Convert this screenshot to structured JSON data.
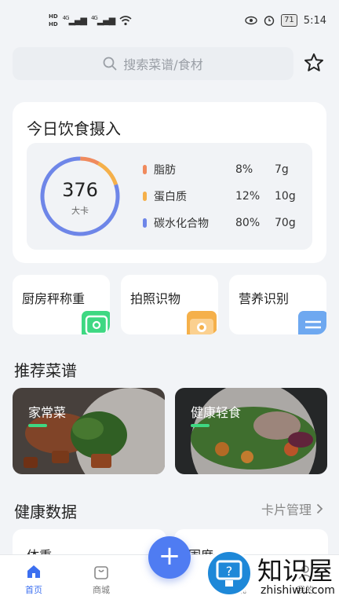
{
  "status_bar": {
    "hd1": "HD",
    "hd2": "HD",
    "signal1": "4G",
    "signal2": "4G",
    "battery": "71",
    "time": "5:14"
  },
  "search": {
    "placeholder": "搜索菜谱/食材"
  },
  "intake": {
    "title": "今日饮食摄入",
    "calories": "376",
    "unit": "大卡",
    "nutrients": [
      {
        "name": "脂肪",
        "percent": "8%",
        "grams": "7g",
        "color": "#f08a5d"
      },
      {
        "name": "蛋白质",
        "percent": "12%",
        "grams": "10g",
        "color": "#f5b04a"
      },
      {
        "name": "碳水化合物",
        "percent": "80%",
        "grams": "70g",
        "color": "#6e86e8"
      }
    ]
  },
  "features": [
    {
      "label": "厨房秤称重",
      "icon": "scale-icon",
      "color": "#3ed882"
    },
    {
      "label": "拍照识物",
      "icon": "camera-icon",
      "color": "#f5b04a"
    },
    {
      "label": "营养识别",
      "icon": "document-icon",
      "color": "#6ea8f0"
    }
  ],
  "recipes": {
    "title": "推荐菜谱",
    "items": [
      {
        "label": "家常菜"
      },
      {
        "label": "健康轻食"
      }
    ]
  },
  "health": {
    "title": "健康数据",
    "manage": "卡片管理",
    "cards": [
      {
        "label": "体重"
      },
      {
        "label": "围度"
      }
    ]
  },
  "tabs": [
    {
      "label": "首页",
      "active": true
    },
    {
      "label": "商城",
      "active": false
    },
    {
      "label": "发现",
      "active": false
    },
    {
      "label": "我的",
      "active": false
    }
  ],
  "watermark": {
    "text": "知识屋",
    "sub": "zhishiwu.com"
  },
  "colors": {
    "accent": "#4f7cf2",
    "green": "#3ed882"
  }
}
